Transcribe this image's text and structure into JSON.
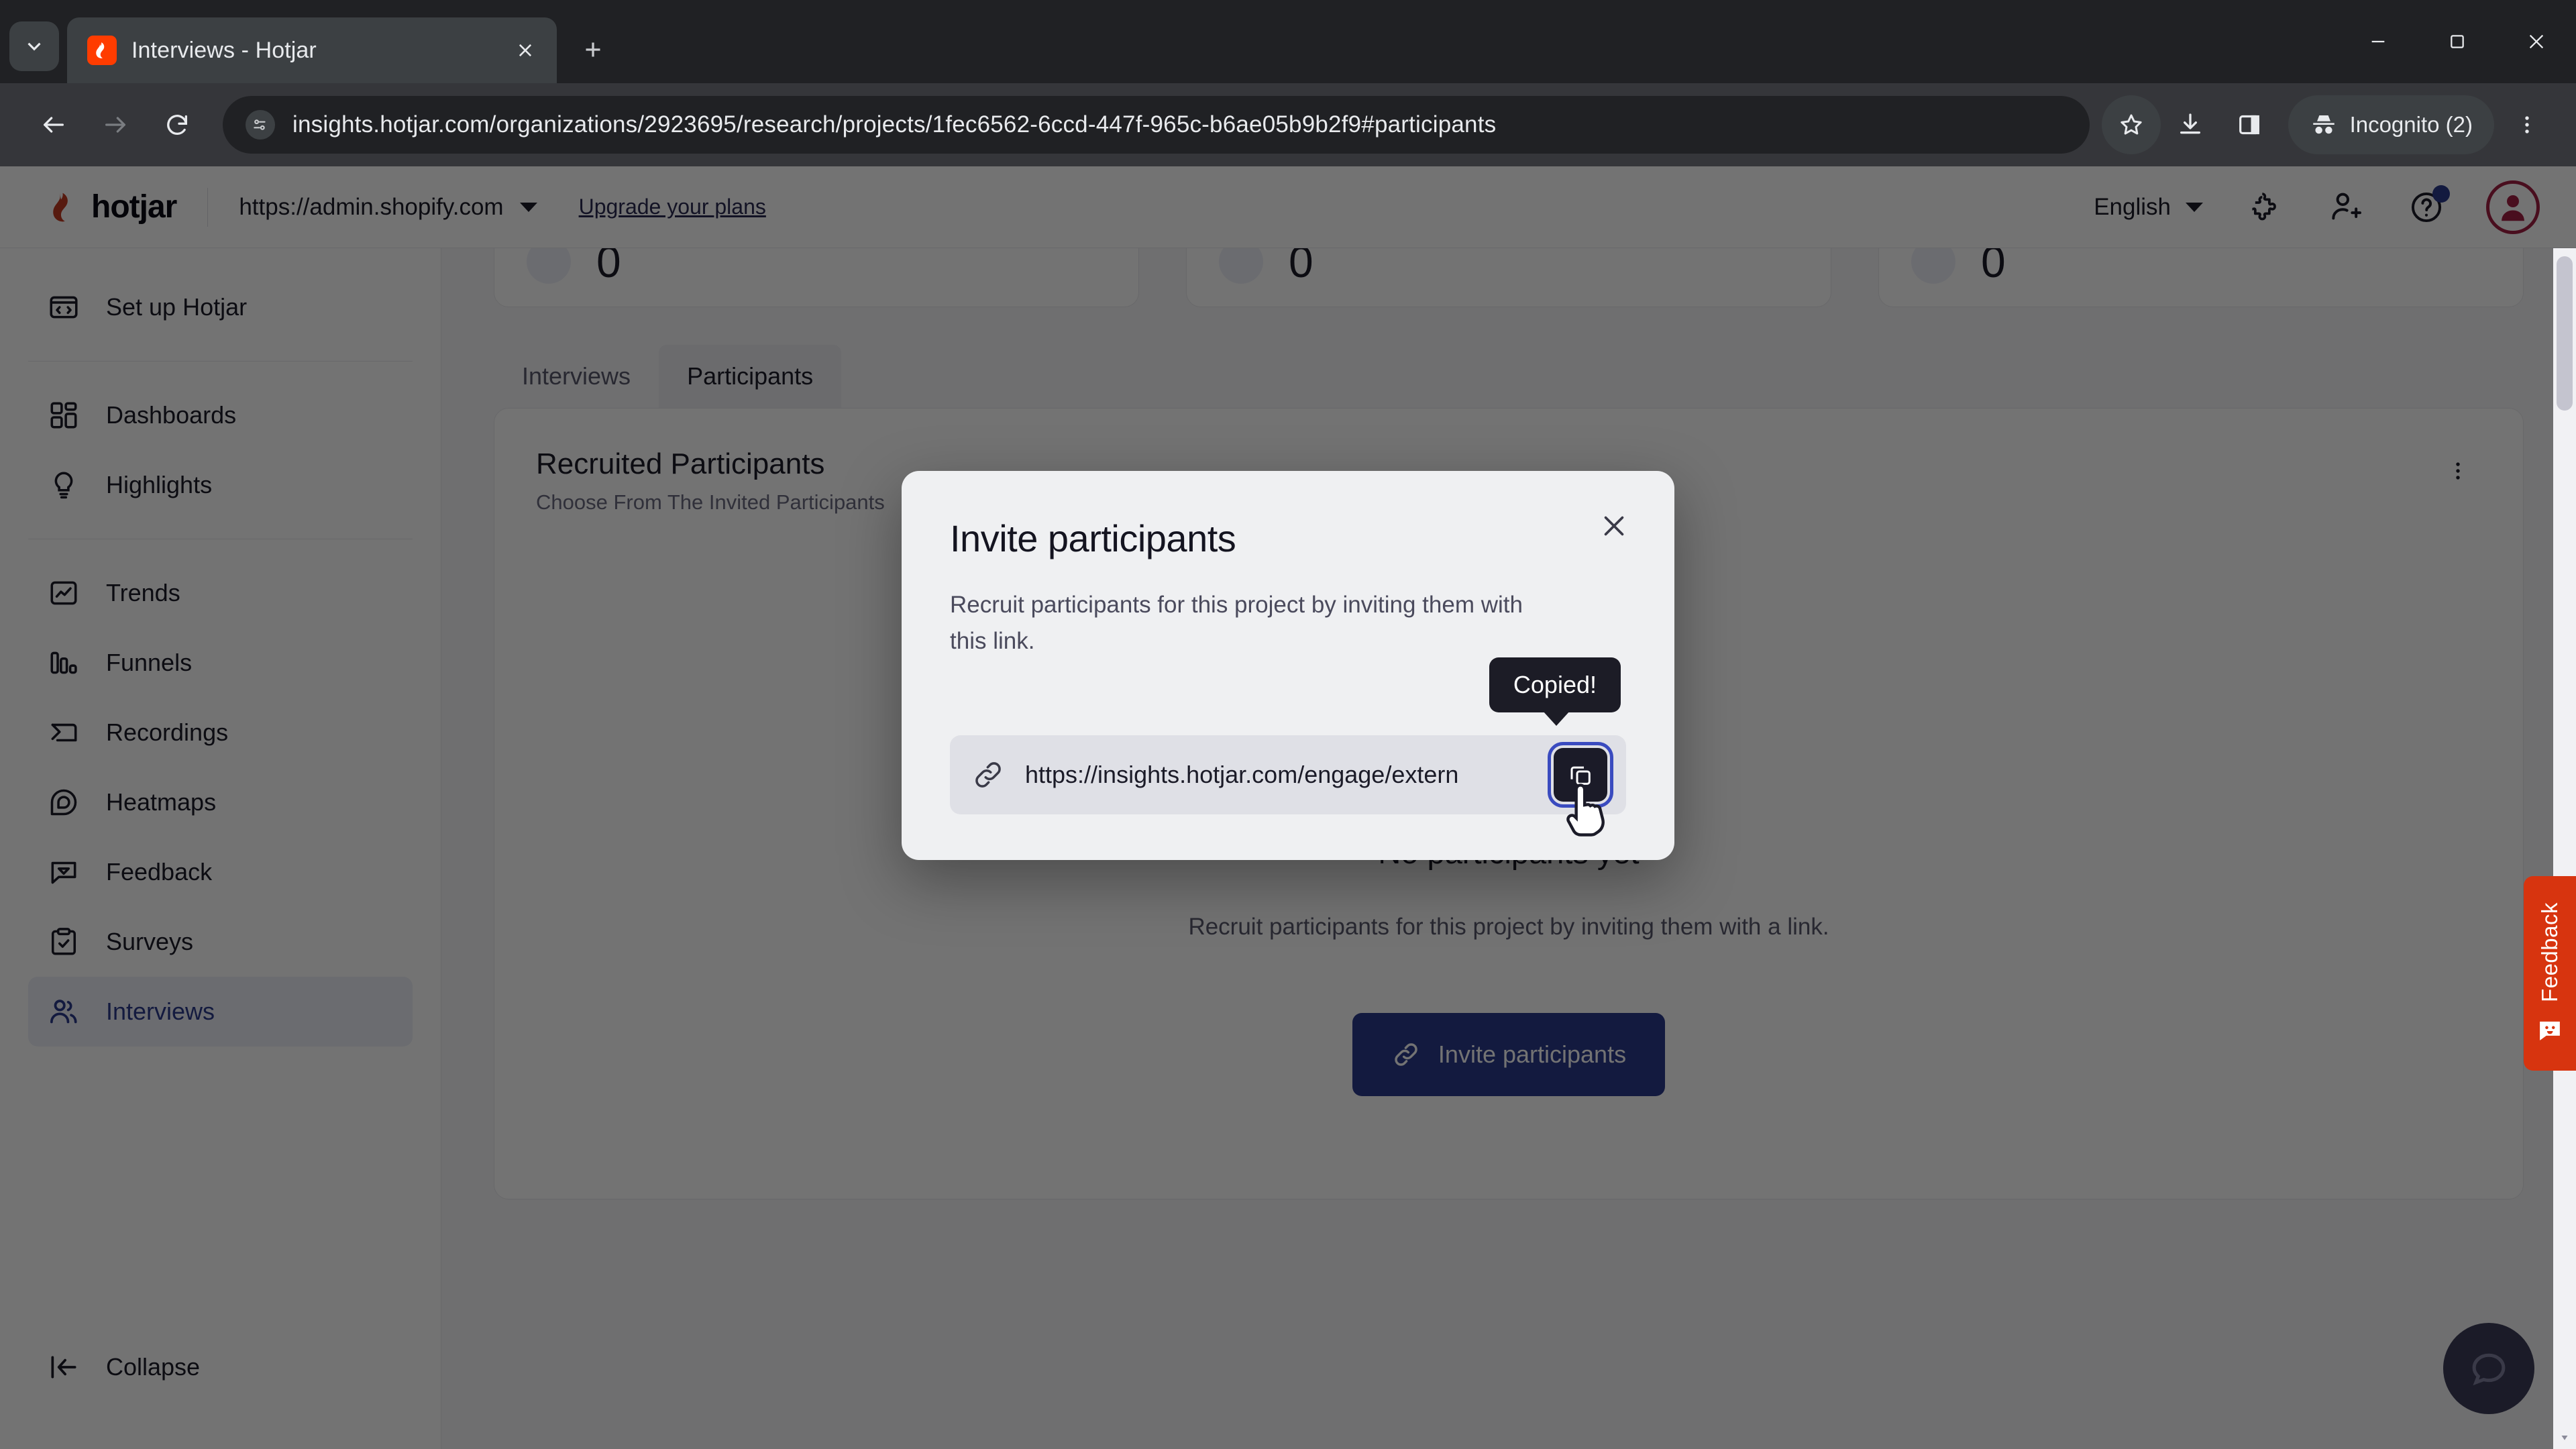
{
  "browser": {
    "tab": {
      "title": "Interviews - Hotjar",
      "favicon_icon": "hotjar-flame-icon"
    },
    "tab_search_icon": "chevron-down-icon",
    "new_tab_icon": "plus-icon",
    "tab_close_icon": "close-icon",
    "window_controls": {
      "minimize_icon": "minimize-icon",
      "maximize_icon": "maximize-icon",
      "close_icon": "window-close-icon"
    },
    "nav": {
      "back_icon": "arrow-left-icon",
      "forward_icon": "arrow-right-icon",
      "reload_icon": "reload-icon"
    },
    "omnibox": {
      "site_info_icon": "site-settings-icon",
      "url": "insights.hotjar.com/organizations/2923695/research/projects/1fec6562-6ccd-447f-965c-b6ae05b9b2f9#participants"
    },
    "actions": {
      "bookmark_icon": "star-icon",
      "downloads_icon": "download-icon",
      "side_panel_icon": "side-panel-icon",
      "profile_label": "Incognito (2)",
      "profile_icon": "incognito-icon",
      "menu_icon": "kebab-menu-icon"
    }
  },
  "app_header": {
    "logo_text": "hotjar",
    "logo_icon": "hotjar-flame-icon",
    "site_selector": {
      "value": "https://admin.shopify.com",
      "caret_icon": "chevron-down-icon"
    },
    "upgrade_link": "Upgrade your plans",
    "language": {
      "value": "English",
      "caret_icon": "chevron-down-icon"
    },
    "icons": {
      "extensions": "puzzle-piece-icon",
      "invite_user": "user-plus-icon",
      "help": "help-circle-icon",
      "avatar": "user-avatar-icon"
    },
    "help_badge": true
  },
  "sidebar": {
    "items": [
      {
        "label": "Set up Hotjar",
        "icon": "code-window-icon",
        "active": false
      },
      {
        "label": "Dashboards",
        "icon": "dashboard-grid-icon",
        "active": false
      },
      {
        "label": "Highlights",
        "icon": "lightbulb-icon",
        "active": false
      },
      {
        "label": "Trends",
        "icon": "trend-chart-icon",
        "active": false
      },
      {
        "label": "Funnels",
        "icon": "funnel-bars-icon",
        "active": false
      },
      {
        "label": "Recordings",
        "icon": "recording-icon",
        "active": false
      },
      {
        "label": "Heatmaps",
        "icon": "heatmap-icon",
        "active": false
      },
      {
        "label": "Feedback",
        "icon": "feedback-bubble-icon",
        "active": false
      },
      {
        "label": "Surveys",
        "icon": "clipboard-check-icon",
        "active": false
      },
      {
        "label": "Interviews",
        "icon": "people-icon",
        "active": true
      }
    ],
    "collapse": {
      "label": "Collapse",
      "icon": "collapse-left-icon"
    }
  },
  "main": {
    "stats": [
      {
        "value": "0",
        "icon": "stat-icon"
      },
      {
        "value": "0",
        "icon": "stat-icon"
      },
      {
        "value": "0",
        "icon": "stat-icon"
      }
    ],
    "tabs": [
      {
        "label": "Interviews",
        "selected": false
      },
      {
        "label": "Participants",
        "selected": true
      }
    ],
    "card": {
      "title": "Recruited Participants",
      "subtitle": "Choose From The Invited Participants",
      "menu_icon": "kebab-menu-icon"
    },
    "empty_state": {
      "illustration": "envelope-and-person-with-plug-illustration",
      "title": "No participants yet",
      "description": "Recruit participants for this project by inviting them with a link.",
      "button": {
        "label": "Invite participants",
        "icon": "link-icon"
      }
    }
  },
  "feedback_tab": {
    "label": "Feedback",
    "icon": "smiley-bubble-icon",
    "color": "#d7340f"
  },
  "chat_widget": {
    "icon": "chat-bubble-icon"
  },
  "modal": {
    "title": "Invite participants",
    "description": "Recruit participants for this project by inviting them with this link.",
    "close_icon": "close-icon",
    "link_icon": "link-icon",
    "link_value": "https://insights.hotjar.com/engage/extern",
    "copy_button_icon": "copy-icon",
    "tooltip": "Copied!"
  },
  "colors": {
    "accent": "#2c3a8c",
    "brand_red": "#FF3C00",
    "feedback_red": "#d7340f",
    "focus_ring": "#3a4bbf"
  }
}
